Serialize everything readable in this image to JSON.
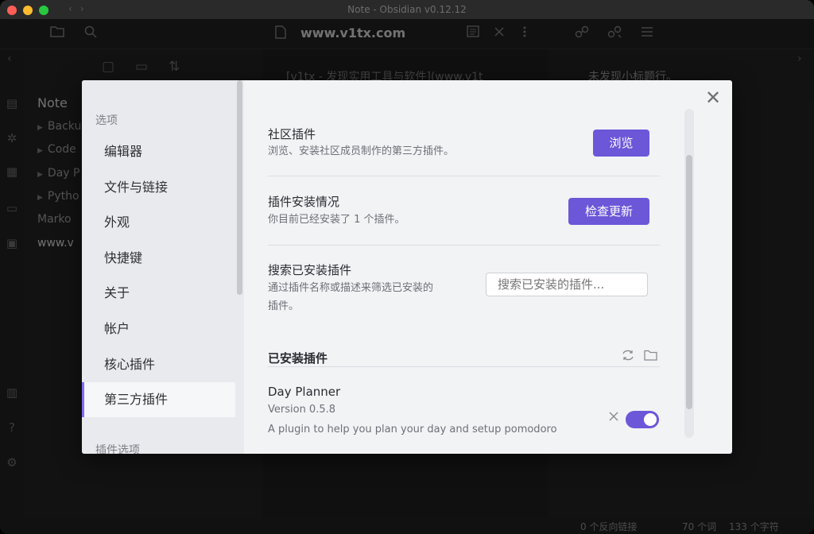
{
  "window": {
    "title": "Note - Obsidian v0.12.12",
    "nav_back": "‹",
    "nav_forward": "›"
  },
  "tab": {
    "title": "www.v1tx.com"
  },
  "left_sidebar": {
    "vault_title": "Note",
    "items": [
      {
        "label": "Backu",
        "folder": true
      },
      {
        "label": "Code",
        "folder": true
      },
      {
        "label": "Day P",
        "folder": true
      },
      {
        "label": "Pytho",
        "folder": true
      },
      {
        "label": "Marko",
        "folder": false
      },
      {
        "label": "www.v",
        "folder": false
      }
    ]
  },
  "editor": {
    "text": "[v1tx - 发现实用工具与软件](www.v1t"
  },
  "right_pane": {
    "text": "未发现小标题行。"
  },
  "statusbar": {
    "backlinks": "0 个反向链接",
    "words": "70 个词",
    "chars": "133 个字符"
  },
  "settings_modal": {
    "sidebar_heading": "选项",
    "sidebar_items": [
      "编辑器",
      "文件与链接",
      "外观",
      "快捷键",
      "关于",
      "帐户",
      "核心插件",
      "第三方插件"
    ],
    "active_item": "第三方插件",
    "sidebar_heading_2": "插件选项",
    "close_label": "✕",
    "settings": {
      "community": {
        "name": "社区插件",
        "desc": "浏览、安装社区成员制作的第三方插件。",
        "button": "浏览"
      },
      "installed_status": {
        "name": "插件安装情况",
        "desc": "你目前已经安装了 1 个插件。",
        "button": "检查更新"
      },
      "search": {
        "name": "搜索已安装插件",
        "desc_line1": "通过插件名称或描述来筛选已安装的",
        "desc_line2": "插件。",
        "placeholder": "搜索已安装的插件..."
      }
    },
    "installed_section": {
      "title": "已安装插件"
    },
    "plugins": [
      {
        "name": "Day Planner",
        "version": "Version 0.5.8",
        "description": "A plugin to help you plan your day and setup pomodoro",
        "enabled": true
      }
    ]
  },
  "colors": {
    "accent": "#6c57d9",
    "modal_bg": "#f2f3f5",
    "sidebar_bg": "#e9eaed",
    "app_bg": "#1e1e1e"
  }
}
